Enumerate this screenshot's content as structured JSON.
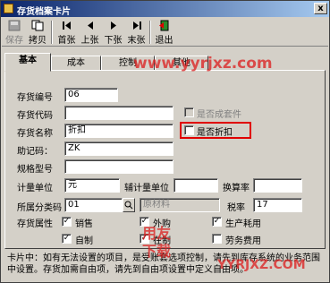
{
  "window": {
    "title": "存货档案卡片",
    "close_label": "x"
  },
  "toolbar": {
    "buttons": [
      {
        "label": "保存",
        "icon": "save-icon",
        "disabled": true
      },
      {
        "label": "拷贝",
        "icon": "copy-icon",
        "disabled": false
      },
      {
        "label": "首张",
        "icon": "first-icon",
        "disabled": false
      },
      {
        "label": "上张",
        "icon": "prev-icon",
        "disabled": false
      },
      {
        "label": "下张",
        "icon": "next-icon",
        "disabled": false
      },
      {
        "label": "末张",
        "icon": "last-icon",
        "disabled": false
      },
      {
        "label": "退出",
        "icon": "exit-icon",
        "disabled": false
      }
    ]
  },
  "tabs": [
    "基本",
    "成本",
    "控制",
    "其他"
  ],
  "form": {
    "code_label": "存货编号",
    "code_value": "06",
    "inv_code_label": "存货代码",
    "inv_code_value": "",
    "name_label": "存货名称",
    "name_value": "折扣",
    "mnemonic_label": "助记码：",
    "mnemonic_value": "ZK",
    "spec_label": "规格型号",
    "spec_value": "",
    "unit_label": "计量单位",
    "unit_value": "元",
    "aux_unit_label": "辅计量单位",
    "aux_unit_value": "",
    "rate_label": "换算率",
    "rate_value": "",
    "category_label": "所属分类码",
    "category_value": "01",
    "category_name": "原材料",
    "tax_label": "税率",
    "tax_value": "17",
    "attr_label": "存货属性",
    "is_kit_label": "是否成套件",
    "is_discount_label": "是否折扣",
    "attributes": {
      "sales": "销售",
      "purchase": "外购",
      "production": "生产耗用",
      "self_made": "自制",
      "in_process": "在制",
      "labor": "劳务费用"
    }
  },
  "status": {
    "line1": "卡片中：如有无法设置的项目，是受账套选项控制，请先到库存系统的业务范围",
    "line2": "中设置。存货加需自由项，请先到自由项设置中定义自由项。"
  },
  "watermarks": {
    "site": "www.yyrjxz.com",
    "brand_top": "用友",
    "brand_bottom": "下载",
    "site_bottom": "YYRJXZ.COM"
  },
  "colors": {
    "titlebar_start": "#0a246a",
    "titlebar_end": "#a6caf0",
    "window_bg": "#d4d0c8",
    "highlight_box": "#e00000",
    "watermark": "#dc1e1e"
  }
}
